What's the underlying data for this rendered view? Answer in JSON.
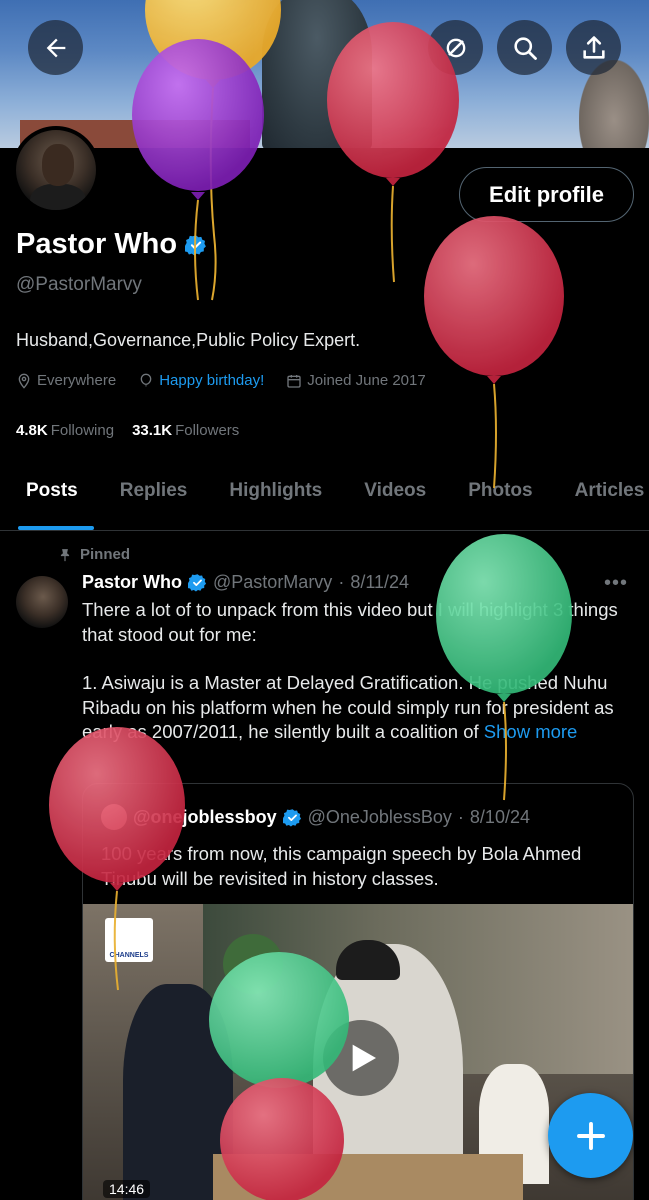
{
  "header": {
    "back_label": "Back",
    "grok_label": "Grok",
    "search_label": "Search",
    "share_label": "Share"
  },
  "profile": {
    "display_name": "Pastor Who",
    "handle": "@PastorMarvy",
    "bio": "Husband,Governance,Public Policy Expert.",
    "location": "Everywhere",
    "birthday": "Happy birthday!",
    "joined": "Joined June 2017",
    "following_count": "4.8K",
    "following_label": "Following",
    "followers_count": "33.1K",
    "followers_label": "Followers",
    "edit_label": "Edit profile"
  },
  "tabs": [
    {
      "label": "Posts",
      "active": true
    },
    {
      "label": "Replies",
      "active": false
    },
    {
      "label": "Highlights",
      "active": false
    },
    {
      "label": "Videos",
      "active": false
    },
    {
      "label": "Photos",
      "active": false
    },
    {
      "label": "Articles",
      "active": false
    }
  ],
  "post": {
    "pinned_label": "Pinned",
    "name": "Pastor Who",
    "handle": "@PastorMarvy",
    "sep": "·",
    "date": "8/11/24",
    "more": "•••",
    "paragraph1": "There a lot of to unpack from this video but I will highlight 3 things that stood out for me:",
    "paragraph2": "1. Asiwaju is a Master at Delayed Gratification. He pushed Nuhu Ribadu on his platform when he could simply run for president as early as 2007/2011, he silently built a coalition of",
    "show_more": "Show more"
  },
  "quote": {
    "name": "@onejoblessboy",
    "handle": "@OneJoblessBoy",
    "sep": "·",
    "date": "8/10/24",
    "text": "100 years from now, this campaign speech by Bola Ahmed Tinubu will be revisited in history classes.",
    "video_duration": "14:46",
    "channel_label": "CHANNELS"
  },
  "colors": {
    "accent": "#1d9bf0",
    "background": "#000000",
    "muted": "#71767b",
    "balloon_yellow": "#f6c544",
    "balloon_purple": "#a43fd8",
    "balloon_red": "#e2465e",
    "balloon_green": "#56d497"
  }
}
